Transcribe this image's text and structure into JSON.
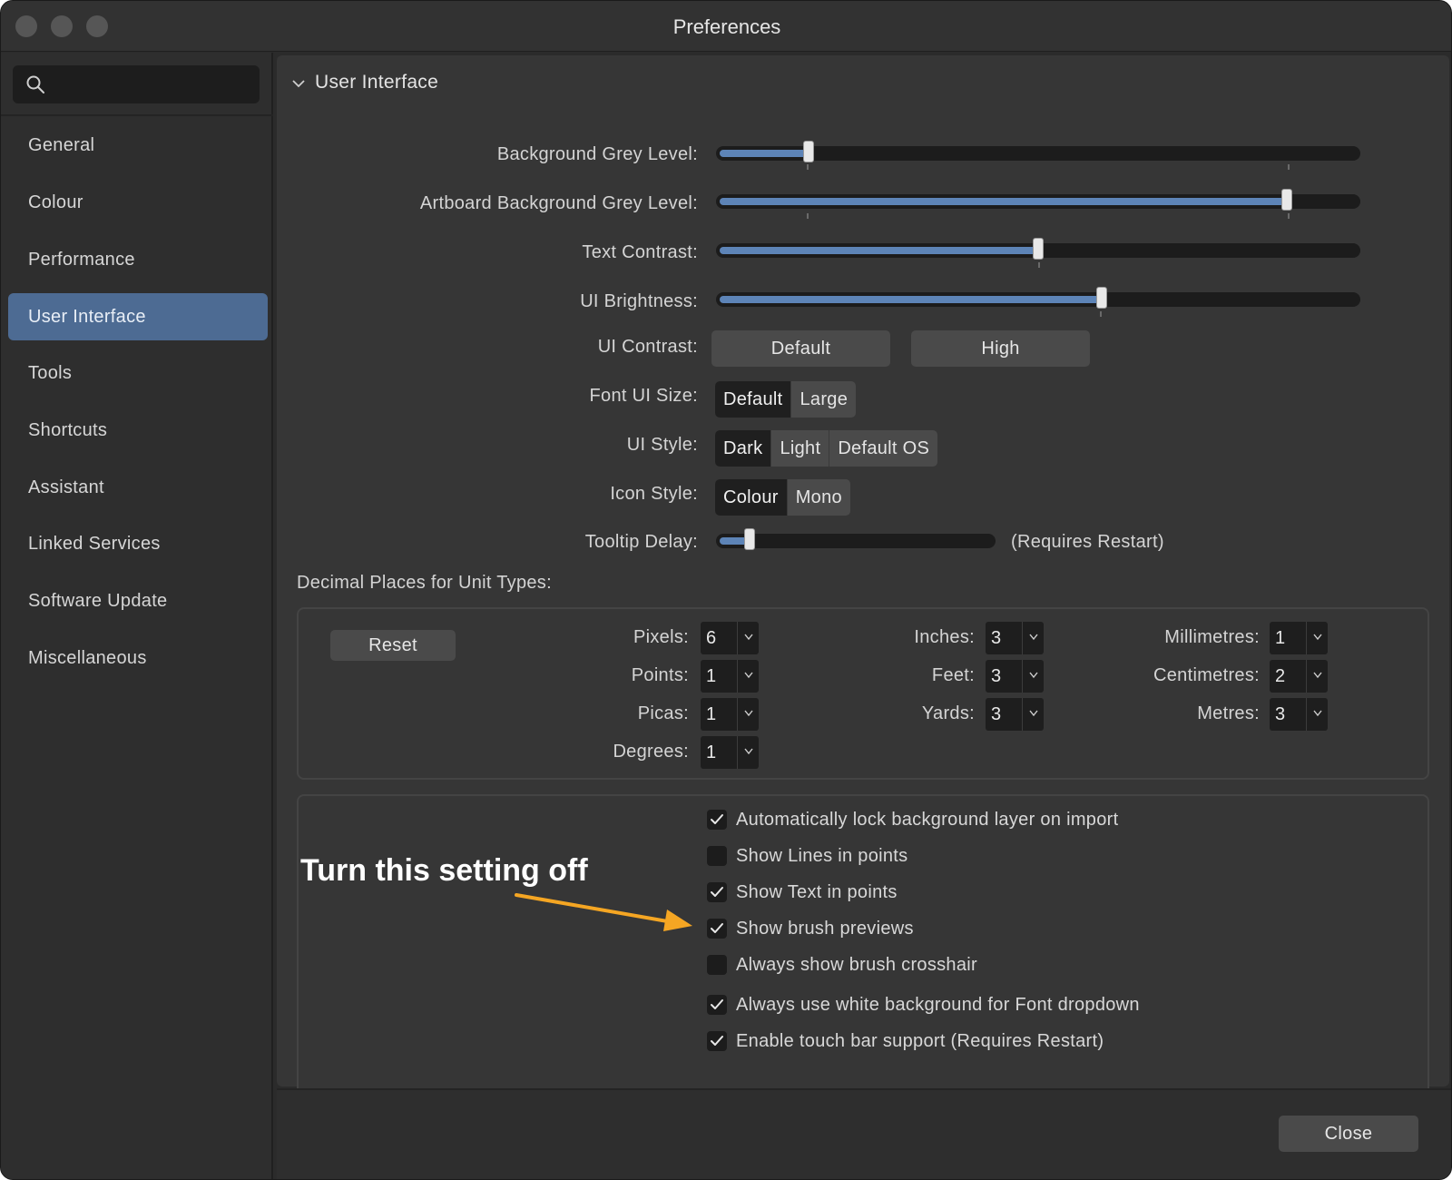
{
  "window": {
    "title": "Preferences"
  },
  "sidebar": {
    "search_placeholder": "",
    "items": [
      {
        "label": "General"
      },
      {
        "label": "Colour"
      },
      {
        "label": "Performance"
      },
      {
        "label": "User Interface"
      },
      {
        "label": "Tools"
      },
      {
        "label": "Shortcuts"
      },
      {
        "label": "Assistant"
      },
      {
        "label": "Linked Services"
      },
      {
        "label": "Software Update"
      },
      {
        "label": "Miscellaneous"
      }
    ],
    "active": "User Interface"
  },
  "section": {
    "title": "User Interface",
    "sliders": [
      {
        "label": "Background Grey Level:",
        "value": 0.14
      },
      {
        "label": "Artboard Background Grey Level:",
        "value": 0.89
      },
      {
        "label": "Text Contrast:",
        "value": 0.5
      },
      {
        "label": "UI Brightness:",
        "value": 0.6
      }
    ],
    "ui_contrast": {
      "label": "UI Contrast:",
      "options": [
        "Default",
        "High"
      ]
    },
    "font_ui_size": {
      "label": "Font UI Size:",
      "options": [
        "Default",
        "Large"
      ],
      "selected": "Default"
    },
    "ui_style": {
      "label": "UI Style:",
      "options": [
        "Dark",
        "Light",
        "Default OS"
      ],
      "selected": "Dark"
    },
    "icon_style": {
      "label": "Icon Style:",
      "options": [
        "Colour",
        "Mono"
      ],
      "selected": "Colour"
    },
    "tooltip_delay": {
      "label": "Tooltip Delay:",
      "value": 0.11,
      "note": "(Requires Restart)"
    }
  },
  "decimal_places": {
    "title": "Decimal Places for Unit Types:",
    "reset_label": "Reset",
    "units": [
      {
        "label": "Pixels:",
        "value": "6"
      },
      {
        "label": "Points:",
        "value": "1"
      },
      {
        "label": "Picas:",
        "value": "1"
      },
      {
        "label": "Degrees:",
        "value": "1"
      },
      {
        "label": "Inches:",
        "value": "3"
      },
      {
        "label": "Feet:",
        "value": "3"
      },
      {
        "label": "Yards:",
        "value": "3"
      },
      {
        "label": "Millimetres:",
        "value": "1"
      },
      {
        "label": "Centimetres:",
        "value": "2"
      },
      {
        "label": "Metres:",
        "value": "3"
      }
    ]
  },
  "checkboxes": [
    {
      "label": "Automatically lock background layer on import",
      "checked": true
    },
    {
      "label": "Show Lines in points",
      "checked": false
    },
    {
      "label": "Show Text in points",
      "checked": true
    },
    {
      "label": "Show brush previews",
      "checked": true
    },
    {
      "label": "Always show brush crosshair",
      "checked": false
    },
    {
      "label": "Always use white background for Font dropdown",
      "checked": true
    },
    {
      "label": "Enable touch bar support (Requires Restart)",
      "checked": true
    }
  ],
  "annotation": {
    "text": "Turn this setting off",
    "color": "#f5a623"
  },
  "footer": {
    "close_label": "Close"
  },
  "colors": {
    "accent": "#4d6b93",
    "slider_fill": "#5d84b7"
  }
}
